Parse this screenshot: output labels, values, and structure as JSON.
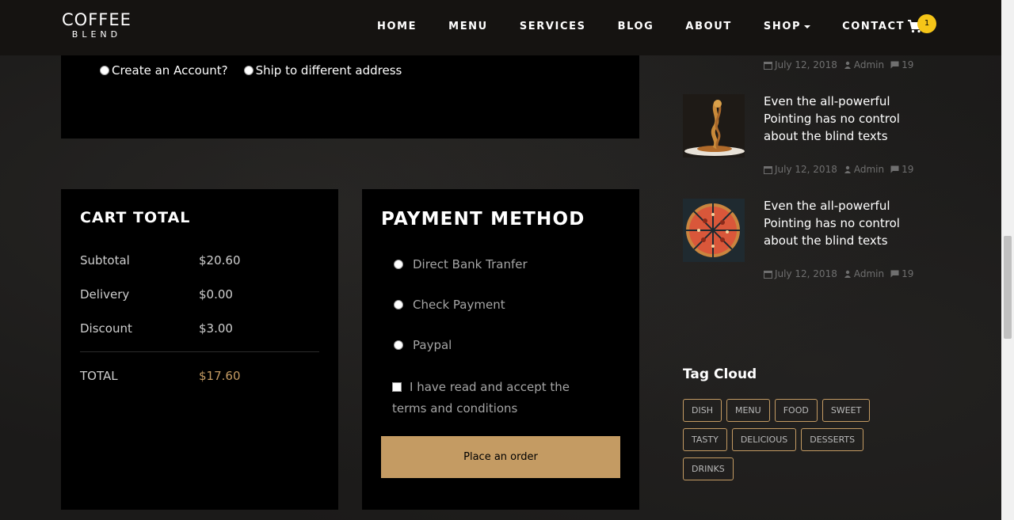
{
  "brand": {
    "line1": "COFFEE",
    "line2": "BLEND"
  },
  "nav": {
    "items": [
      "HOME",
      "MENU",
      "SERVICES",
      "BLOG",
      "ABOUT",
      "SHOP",
      "CONTACT"
    ],
    "cart_count": "1",
    "cart_icon": "cart-icon"
  },
  "billing": {
    "create_account": "Create an Account?",
    "ship_different": "Ship to different address"
  },
  "cart_total": {
    "title": "CART TOTAL",
    "rows": [
      {
        "label": "Subtotal",
        "value": "$20.60"
      },
      {
        "label": "Delivery",
        "value": "$0.00"
      },
      {
        "label": "Discount",
        "value": "$3.00"
      }
    ],
    "total_label": "TOTAL",
    "total_value": "$17.60"
  },
  "payment": {
    "title": "PAYMENT METHOD",
    "options": [
      "Direct Bank Tranfer",
      "Check Payment",
      "Paypal"
    ],
    "terms": "I have read and accept the terms and conditions",
    "order_button": "Place an order"
  },
  "sidebar": {
    "top_meta": {
      "date": "July 12, 2018",
      "author": "Admin",
      "comments": "19"
    },
    "posts": [
      {
        "title": "Even the all-powerful Pointing has no control about the blind texts",
        "date": "July 12, 2018",
        "author": "Admin",
        "comments": "19"
      },
      {
        "title": "Even the all-powerful Pointing has no control about the blind texts",
        "date": "July 12, 2018",
        "author": "Admin",
        "comments": "19"
      }
    ],
    "tag_cloud_title": "Tag Cloud",
    "tags": [
      "DISH",
      "MENU",
      "FOOD",
      "SWEET",
      "TASTY",
      "DELICIOUS",
      "DESSERTS",
      "DRINKS"
    ]
  },
  "colors": {
    "accent": "#c49b63",
    "badge": "#f5c518",
    "panel": "#000000",
    "navbar": "#151311"
  }
}
